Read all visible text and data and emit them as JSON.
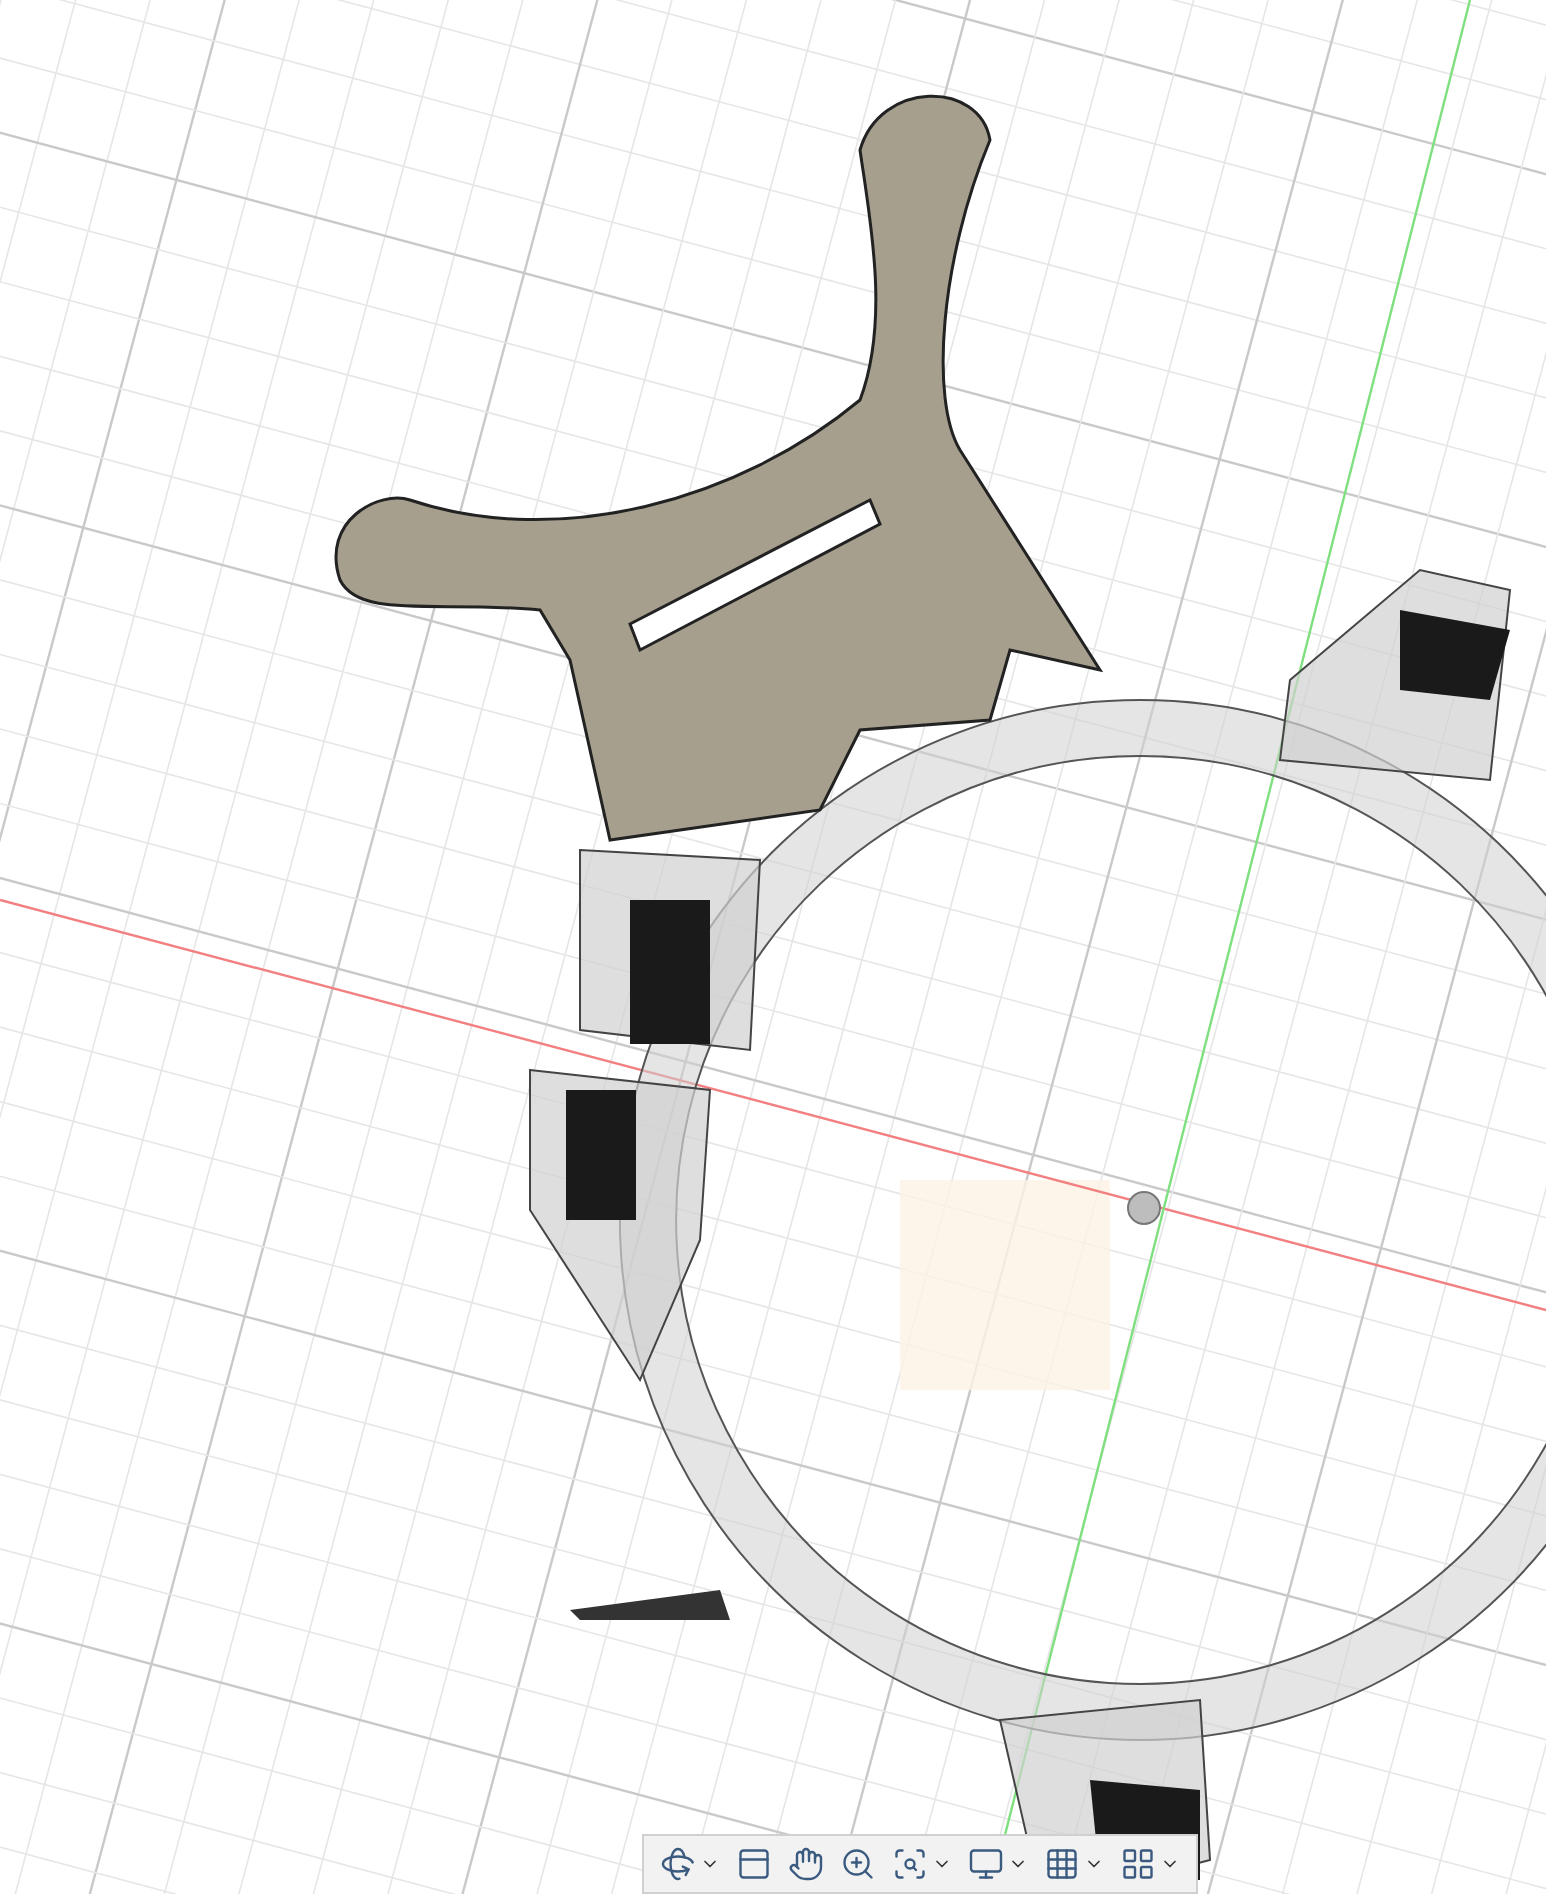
{
  "toolbar": [
    {
      "kind": "orbit",
      "dropdown": true
    },
    {
      "kind": "look_at",
      "dropdown": false
    },
    {
      "kind": "pan",
      "dropdown": false
    },
    {
      "kind": "zoom",
      "dropdown": false
    },
    {
      "kind": "fit",
      "dropdown": true
    },
    {
      "kind": "display",
      "dropdown": true
    },
    {
      "kind": "grid",
      "dropdown": true
    },
    {
      "kind": "viewports",
      "dropdown": true
    }
  ]
}
